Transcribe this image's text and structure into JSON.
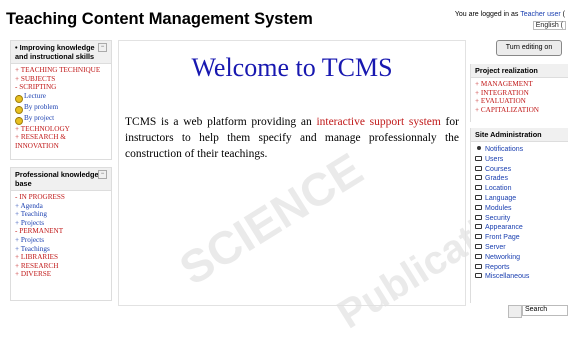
{
  "header": {
    "site_title": "Teaching Content Management System",
    "login_prefix": "You are logged in as",
    "login_user": "Teacher user",
    "login_suffix": "(",
    "language": "English ("
  },
  "left_block_1": {
    "title": "• Improving knowledge and instructional skills",
    "items": [
      {
        "text": "+ TEACHING TECHNIQUE",
        "color": "red"
      },
      {
        "text": "+ SUBJECTS",
        "color": "red"
      },
      {
        "text": "- SCRIPTING",
        "color": "red"
      },
      {
        "text": "Lecture",
        "color": "blue",
        "icon": "smiley-icon"
      },
      {
        "text": "By problem",
        "color": "blue",
        "icon": "smiley-icon"
      },
      {
        "text": "By project",
        "color": "blue",
        "icon": "smiley-icon"
      },
      {
        "text": "+ TECHNOLOGY",
        "color": "red"
      },
      {
        "text": "+ RESEARCH & INNOVATION",
        "color": "red"
      }
    ]
  },
  "left_block_2": {
    "title": "Professional knowledge base",
    "items": [
      {
        "text": "- IN PROGRESS",
        "color": "red"
      },
      {
        "text": "+ Agenda",
        "color": "blue"
      },
      {
        "text": "+ Teaching",
        "color": "blue"
      },
      {
        "text": "+ Projects",
        "color": "blue"
      },
      {
        "text": "- PERMANENT",
        "color": "red"
      },
      {
        "text": "+ Projects",
        "color": "blue"
      },
      {
        "text": "+ Teachings",
        "color": "blue"
      },
      {
        "text": "+ LIBRARIES",
        "color": "red"
      },
      {
        "text": "+ RESEARCH",
        "color": "red"
      },
      {
        "text": "+ DIVERSE",
        "color": "red"
      }
    ]
  },
  "main": {
    "welcome": "Welcome to TCMS",
    "intro_before": "TCMS is a web platform providing an ",
    "intro_highlight": "interactive support system",
    "intro_after": " for instructors to help them specify and manage professionnaly the construction of their teachings."
  },
  "right": {
    "edit_button": "Turn editing on",
    "project_title": "Project realization",
    "project_items": [
      "+ MANAGEMENT",
      "+ INTEGRATION",
      "+ EVALUATION",
      "+ CAPITALIZATION"
    ],
    "admin_title": "Site Administration",
    "admin_items": [
      "Notifications",
      "Users",
      "Courses",
      "Grades",
      "Location",
      "Language",
      "Modules",
      "Security",
      "Appearance",
      "Front Page",
      "Server",
      "Networking",
      "Reports",
      "Miscellaneous"
    ],
    "search_button": "Search"
  },
  "colors": {
    "red": "#c01818",
    "blue": "#1a3fb0",
    "title_blue": "#1818b0"
  }
}
